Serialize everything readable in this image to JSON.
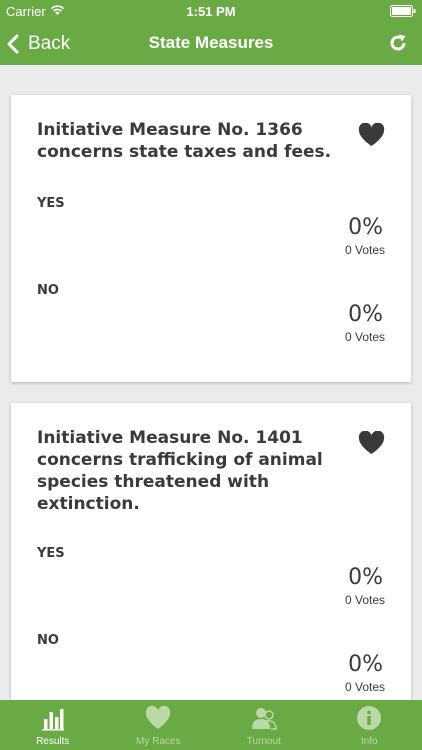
{
  "status_bar": {
    "carrier": "Carrier",
    "time": "1:51 PM"
  },
  "nav": {
    "back_label": "Back",
    "title": "State Measures"
  },
  "measures": [
    {
      "title": "Initiative Measure No. 1366 concerns state taxes and fees.",
      "options": [
        {
          "label": "YES",
          "percent": "0%",
          "votes": "0 Votes"
        },
        {
          "label": "NO",
          "percent": "0%",
          "votes": "0 Votes"
        }
      ]
    },
    {
      "title": "Initiative Measure No. 1401 concerns trafficking of animal species threatened with extinction.",
      "options": [
        {
          "label": "YES",
          "percent": "0%",
          "votes": "0 Votes"
        },
        {
          "label": "NO",
          "percent": "0%",
          "votes": "0 Votes"
        }
      ]
    }
  ],
  "tabs": [
    {
      "label": "Results",
      "icon": "bar-chart-icon"
    },
    {
      "label": "My Races",
      "icon": "heart-icon"
    },
    {
      "label": "Turnout",
      "icon": "people-icon"
    },
    {
      "label": "Info",
      "icon": "info-icon"
    }
  ],
  "colors": {
    "brand_green": "#6aaa45",
    "inactive_tab": "#b9d9a6",
    "text_dark": "#3a3a3a",
    "background": "#ebebeb"
  }
}
